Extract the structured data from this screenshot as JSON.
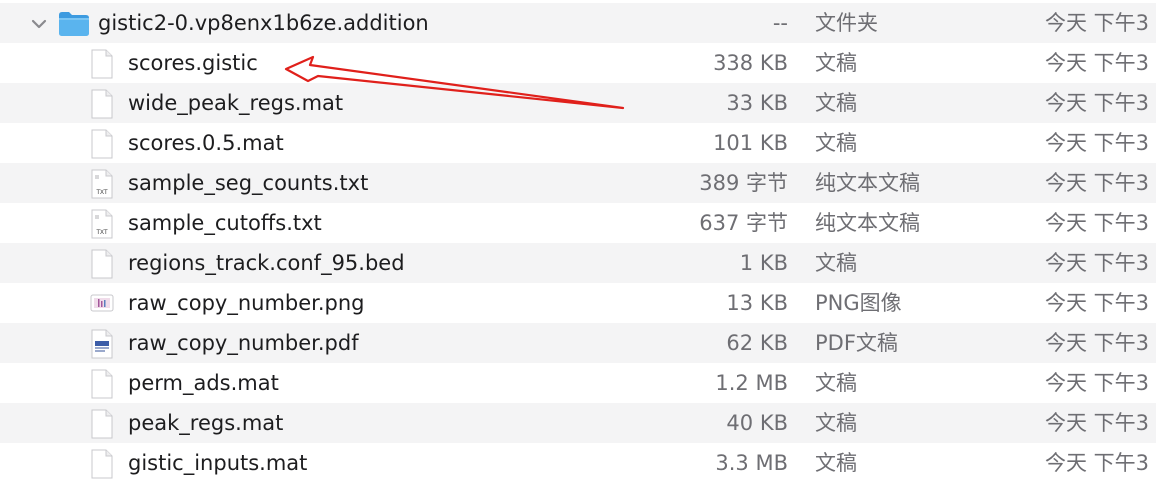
{
  "folder": {
    "name": "gistic2-0.vp8enx1b6ze.addition",
    "size": "--",
    "kind": "文件夹",
    "date": "今天 下午3"
  },
  "files": [
    {
      "name": "scores.gistic",
      "size": "338 KB",
      "kind": "文稿",
      "date": "今天 下午3",
      "icon": "document-icon"
    },
    {
      "name": "wide_peak_regs.mat",
      "size": "33 KB",
      "kind": "文稿",
      "date": "今天 下午3",
      "icon": "document-icon"
    },
    {
      "name": "scores.0.5.mat",
      "size": "101 KB",
      "kind": "文稿",
      "date": "今天 下午3",
      "icon": "document-icon"
    },
    {
      "name": "sample_seg_counts.txt",
      "size": "389 字节",
      "kind": "纯文本文稿",
      "date": "今天 下午3",
      "icon": "txt-file-icon",
      "icon_label": "TXT"
    },
    {
      "name": "sample_cutoffs.txt",
      "size": "637 字节",
      "kind": "纯文本文稿",
      "date": "今天 下午3",
      "icon": "txt-file-icon",
      "icon_label": "TXT"
    },
    {
      "name": "regions_track.conf_95.bed",
      "size": "1 KB",
      "kind": "文稿",
      "date": "今天 下午3",
      "icon": "document-icon"
    },
    {
      "name": "raw_copy_number.png",
      "size": "13 KB",
      "kind": "PNG图像",
      "date": "今天 下午3",
      "icon": "png-image-icon"
    },
    {
      "name": "raw_copy_number.pdf",
      "size": "62 KB",
      "kind": "PDF文稿",
      "date": "今天 下午3",
      "icon": "pdf-file-icon"
    },
    {
      "name": "perm_ads.mat",
      "size": "1.2 MB",
      "kind": "文稿",
      "date": "今天 下午3",
      "icon": "document-icon"
    },
    {
      "name": "peak_regs.mat",
      "size": "40 KB",
      "kind": "文稿",
      "date": "今天 下午3",
      "icon": "document-icon"
    },
    {
      "name": "gistic_inputs.mat",
      "size": "3.3 MB",
      "kind": "文稿",
      "date": "今天 下午3",
      "icon": "document-icon"
    }
  ],
  "colors": {
    "folder_blue": "#5ab4ee",
    "annotation_red": "#e0201b",
    "row_alt": "#f4f4f5",
    "secondary_text": "#6e6e73"
  }
}
